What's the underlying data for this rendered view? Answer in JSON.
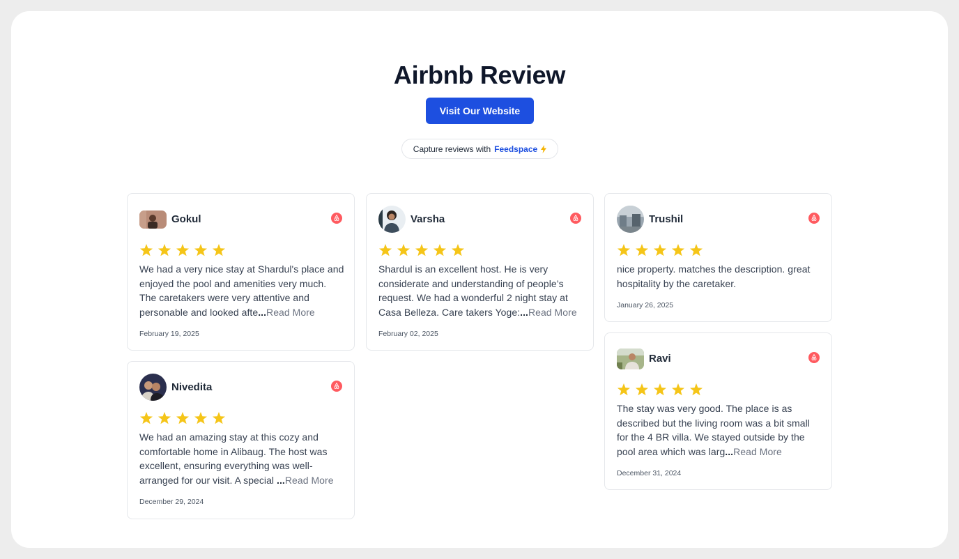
{
  "page": {
    "title": "Airbnb Review",
    "visit_button": "Visit Our Website",
    "capture_prefix": "Capture reviews with",
    "capture_brand": "Feedspace"
  },
  "colors": {
    "accent": "#1d4fe0",
    "star": "#f5c518",
    "airbnb": "#ff5a5f"
  },
  "reviews": [
    {
      "name": "Gokul",
      "rating": 5,
      "text": "We had a very nice stay at Shardul's place and enjoyed the pool and amenities very much. The caretakers were very attentive and personable and looked afte",
      "ellipsis": "...",
      "read_more": "Read More",
      "date": "February 19, 2025",
      "icon": "airbnb-icon"
    },
    {
      "name": "Varsha",
      "rating": 5,
      "text": "Shardul is an excellent host. He is very considerate and understanding of people’s request. We had a wonderful 2 night stay at Casa Belleza. Care takers Yoge:",
      "ellipsis": "...",
      "read_more": "Read More",
      "date": "February 02, 2025",
      "icon": "airbnb-icon"
    },
    {
      "name": "Trushil",
      "rating": 5,
      "text": "nice property. matches the description. great hospitality by the caretaker.",
      "ellipsis": "",
      "read_more": "",
      "date": "January 26, 2025",
      "icon": "airbnb-icon"
    },
    {
      "name": "Nivedita",
      "rating": 5,
      "text": "We had an amazing stay at this cozy and comfortable home in Alibaug. The host was excellent, ensuring everything was well-arranged for our visit. A special ",
      "ellipsis": "...",
      "read_more": "Read More",
      "date": "December 29, 2024",
      "icon": "airbnb-icon"
    },
    {
      "name": "Ravi",
      "rating": 5,
      "text": "The stay was very good. The place is as described but the living room was a bit small for the 4 BR villa. We stayed outside by the pool area which was larg",
      "ellipsis": "...",
      "read_more": "Read More",
      "date": "December 31, 2024",
      "icon": "airbnb-icon"
    }
  ]
}
